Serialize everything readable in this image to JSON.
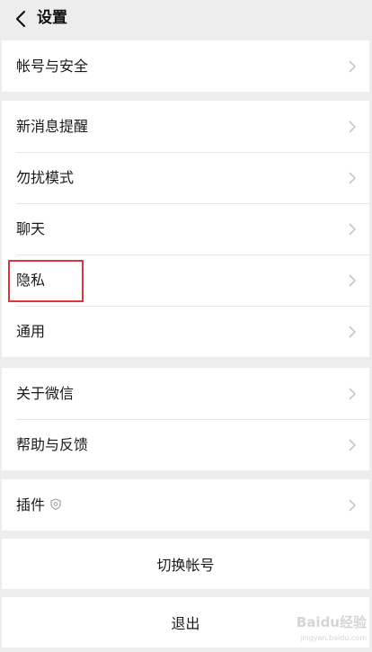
{
  "header": {
    "title": "设置",
    "back_icon": "chevron-left-icon"
  },
  "groups": [
    {
      "items": [
        {
          "label": "帐号与安全"
        }
      ]
    },
    {
      "items": [
        {
          "label": "新消息提醒"
        },
        {
          "label": "勿扰模式"
        },
        {
          "label": "聊天"
        },
        {
          "label": "隐私"
        },
        {
          "label": "通用"
        }
      ]
    },
    {
      "items": [
        {
          "label": "关于微信"
        },
        {
          "label": "帮助与反馈"
        }
      ]
    },
    {
      "items": [
        {
          "label": "插件",
          "icon": "shield-icon"
        }
      ]
    }
  ],
  "actions": {
    "switch_account": "切换帐号",
    "logout": "退出"
  },
  "watermark": {
    "text": "Baidu经验",
    "subtext": "jingyan.baidu.com"
  },
  "colors": {
    "background": "#ededed",
    "card": "#ffffff",
    "highlight": "#d9363e",
    "chevron": "#c7c7cc"
  }
}
